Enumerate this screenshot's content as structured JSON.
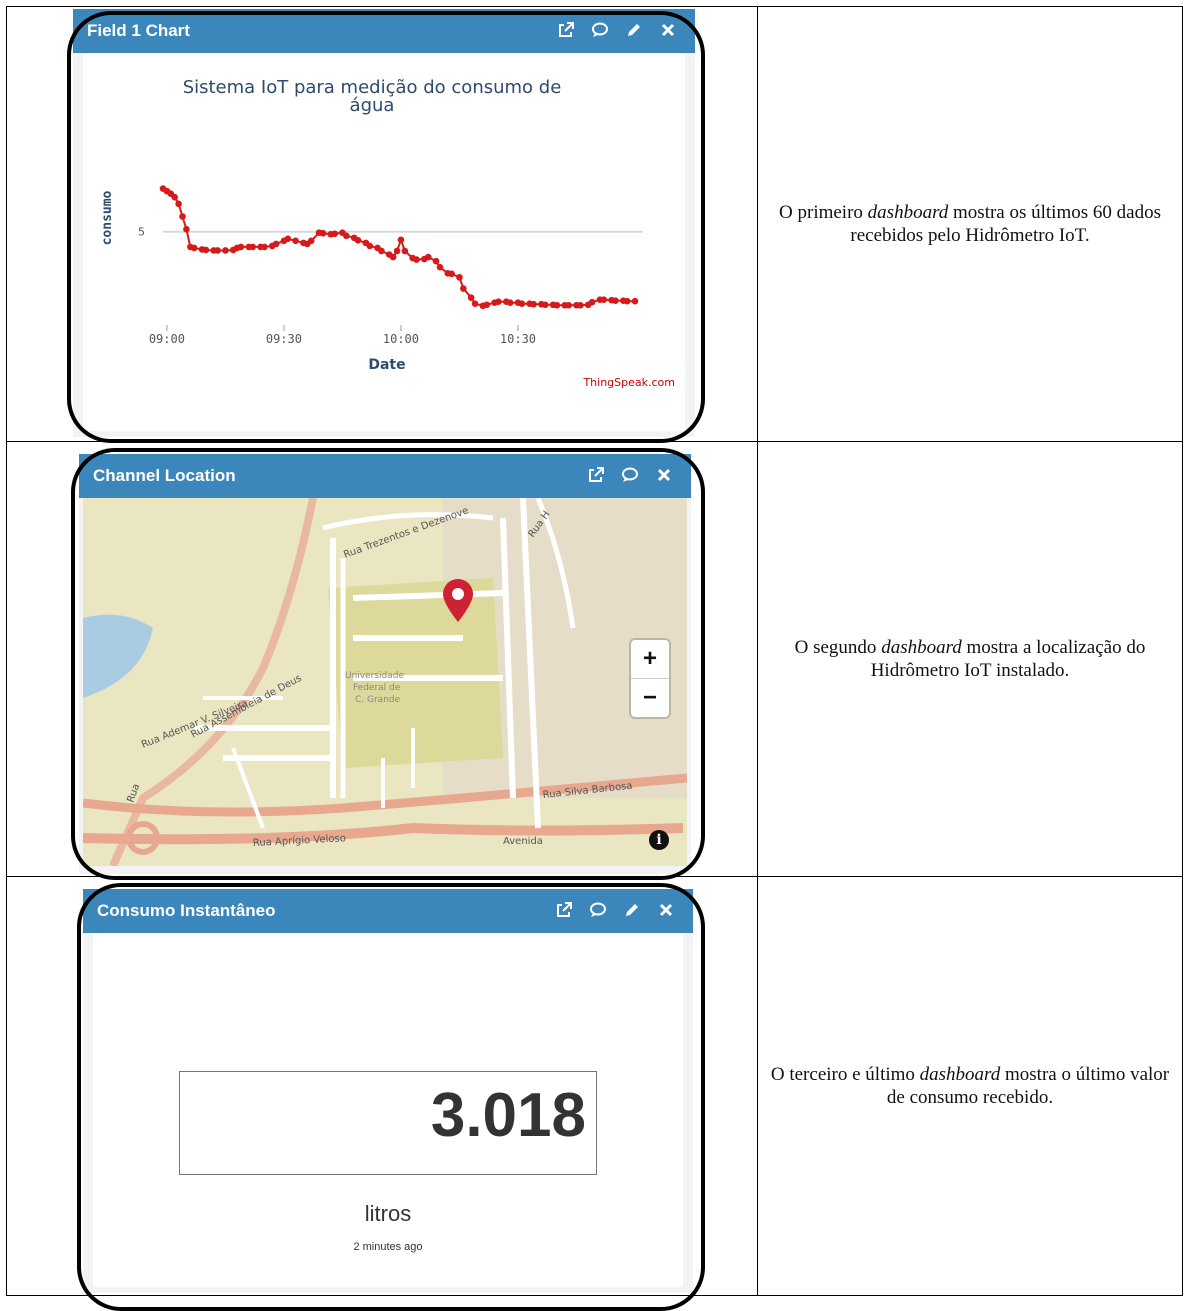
{
  "chart_widget": {
    "title": "Field 1 Chart",
    "header_icons": [
      "external-link-icon",
      "comment-icon",
      "pencil-icon",
      "close-icon"
    ],
    "credit": "ThingSpeak.com"
  },
  "chart_data": {
    "type": "line",
    "title": "Sistema IoT para medição do consumo de água",
    "xlabel": "Date",
    "ylabel": "consumo",
    "x_ticks": [
      "09:00",
      "09:30",
      "10:00",
      "10:30"
    ],
    "y_ticks": [
      5
    ],
    "series": [
      {
        "color": "#d61a1a",
        "x": [
          "08:59",
          "09:00",
          "09:01",
          "09:02",
          "09:03",
          "09:04",
          "09:05",
          "09:06",
          "09:07",
          "09:09",
          "09:10",
          "09:12",
          "09:13",
          "09:15",
          "09:17",
          "09:18",
          "09:19",
          "09:21",
          "09:22",
          "09:24",
          "09:25",
          "09:27",
          "09:28",
          "09:30",
          "09:31",
          "09:33",
          "09:35",
          "09:36",
          "09:37",
          "09:39",
          "09:40",
          "09:42",
          "09:43",
          "09:45",
          "09:46",
          "09:48",
          "09:49",
          "09:51",
          "09:52",
          "09:54",
          "09:55",
          "09:57",
          "09:58",
          "09:59",
          "10:00",
          "10:01",
          "10:03",
          "10:04",
          "10:06",
          "10:07",
          "10:09",
          "10:10",
          "10:12",
          "10:13",
          "10:15",
          "10:16",
          "10:18",
          "10:19",
          "10:21",
          "10:22",
          "10:24",
          "10:25",
          "10:27",
          "10:28",
          "10:30",
          "10:31",
          "10:33",
          "10:34",
          "10:36",
          "10:37",
          "10:39",
          "10:40",
          "10:42",
          "10:43",
          "10:45",
          "10:46",
          "10:48",
          "10:49",
          "10:51",
          "10:52",
          "10:54",
          "10:55",
          "10:57",
          "10:58",
          "11:00"
        ],
        "values": [
          5.85,
          5.8,
          5.75,
          5.68,
          5.55,
          5.3,
          5.05,
          4.7,
          4.68,
          4.65,
          4.64,
          4.63,
          4.63,
          4.63,
          4.64,
          4.68,
          4.7,
          4.7,
          4.7,
          4.7,
          4.7,
          4.72,
          4.76,
          4.82,
          4.86,
          4.82,
          4.78,
          4.76,
          4.82,
          4.98,
          4.97,
          4.95,
          4.96,
          4.98,
          4.92,
          4.88,
          4.83,
          4.78,
          4.72,
          4.68,
          4.62,
          4.55,
          4.5,
          4.62,
          4.84,
          4.62,
          4.48,
          4.45,
          4.46,
          4.5,
          4.42,
          4.3,
          4.18,
          4.17,
          4.1,
          3.88,
          3.7,
          3.58,
          3.54,
          3.56,
          3.6,
          3.62,
          3.62,
          3.6,
          3.6,
          3.58,
          3.58,
          3.57,
          3.57,
          3.56,
          3.56,
          3.55,
          3.55,
          3.55,
          3.55,
          3.55,
          3.56,
          3.61,
          3.66,
          3.66,
          3.65,
          3.64,
          3.64,
          3.63,
          3.63
        ]
      }
    ]
  },
  "map_widget": {
    "title": "Channel Location",
    "header_icons": [
      "external-link-icon",
      "comment-icon",
      "close-icon"
    ],
    "zoom_in": "+",
    "zoom_out": "−",
    "info": "i",
    "labels": {
      "rua_trezentos": "Rua Trezentos e Dezenove",
      "rua_h": "Rua H",
      "rua_ademar": "Rua Ademar V. Silveira",
      "rua_assembleia": "Rua Assembleia de Deus",
      "universidade": "Universidade",
      "federal": "Federal de",
      "cgrande": "C. Grande",
      "rua_silva": "Rua Silva Barbosa",
      "rua_aprigio": "Rua Aprígio Veloso",
      "avenida": "Avenida",
      "rua_left": "Rua"
    }
  },
  "gauge_widget": {
    "title": "Consumo Instantâneo",
    "header_icons": [
      "external-link-icon",
      "comment-icon",
      "pencil-icon",
      "close-icon"
    ],
    "value": "3.018",
    "unit": "litros",
    "updated": "2 minutes ago"
  },
  "captions": {
    "row1_before": "O primeiro ",
    "row1_em": "dashboard",
    "row1_after": " mostra os últimos 60 dados recebidos pelo Hidrômetro IoT.",
    "row2_before": "O segundo ",
    "row2_em": "dashboard",
    "row2_after": " mostra a localização do Hidrômetro IoT instalado.",
    "row3_before": "O terceiro e último ",
    "row3_em": "dashboard",
    "row3_after": " mostra o último valor de consumo recebido."
  }
}
